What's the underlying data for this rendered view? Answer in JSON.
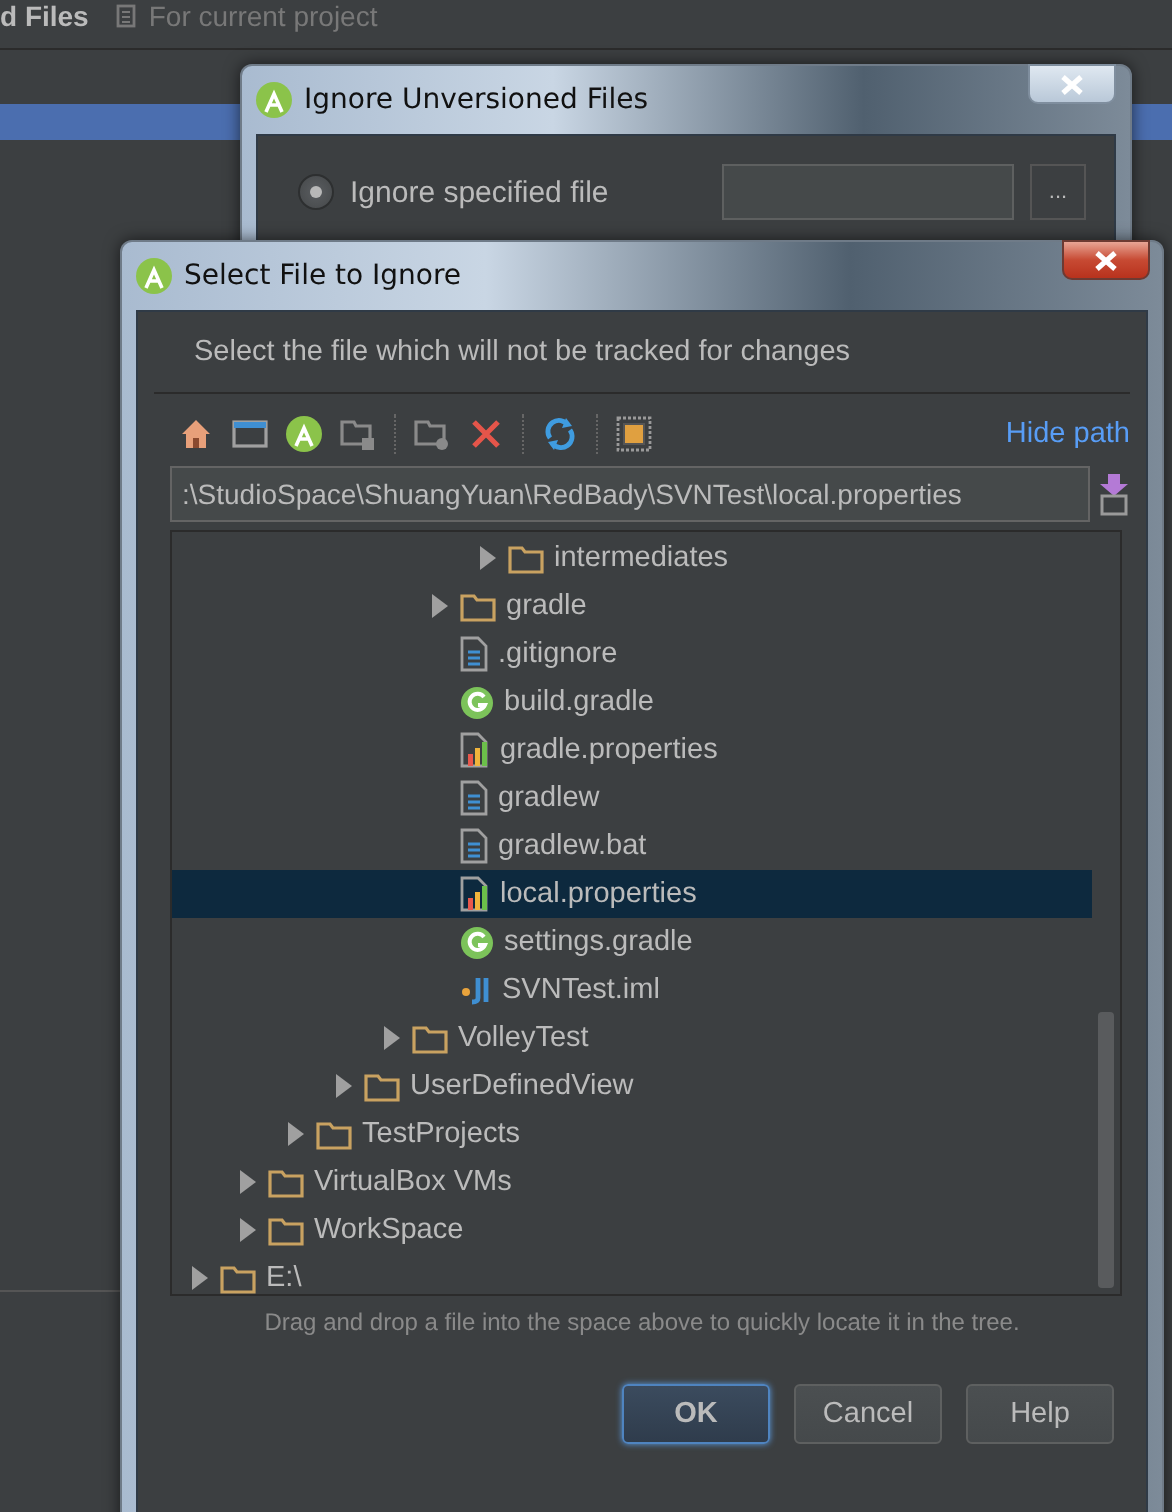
{
  "ide": {
    "title": "d Files",
    "subtitle": "For current project"
  },
  "back_dialog": {
    "title": "Ignore Unversioned Files",
    "option": {
      "label": "Ignore specified file",
      "selected": true
    },
    "browse_button": "..."
  },
  "dialog": {
    "title": "Select File to Ignore",
    "description": "Select the file which will not be tracked for changes",
    "hide_path_link": "Hide path",
    "path": ":\\StudioSpace\\ShuangYuan\\RedBady\\SVNTest\\local.properties",
    "tree": [
      {
        "children": [
          {
            "children": [
              {
                "children": [
                  {
                    "children": [
                      {
                        "children": [
                          {
                            "children": [
                              {
                                "label": "intermediates",
                                "kind": "folder",
                                "expanded": false,
                                "selected": false
                              }
                            ]
                          },
                          {
                            "label": "gradle",
                            "kind": "folder",
                            "expanded": false,
                            "selected": false
                          },
                          {
                            "label": ".gitignore",
                            "kind": "text",
                            "selected": false
                          },
                          {
                            "label": "build.gradle",
                            "kind": "gradle",
                            "selected": false
                          },
                          {
                            "label": "gradle.properties",
                            "kind": "properties",
                            "selected": false
                          },
                          {
                            "label": "gradlew",
                            "kind": "text",
                            "selected": false
                          },
                          {
                            "label": "gradlew.bat",
                            "kind": "text",
                            "selected": false
                          },
                          {
                            "label": "local.properties",
                            "kind": "properties",
                            "selected": true
                          },
                          {
                            "label": "settings.gradle",
                            "kind": "gradle",
                            "selected": false
                          },
                          {
                            "label": "SVNTest.iml",
                            "kind": "module",
                            "selected": false
                          }
                        ]
                      },
                      {
                        "label": "VolleyTest",
                        "kind": "folder",
                        "expanded": false,
                        "selected": false
                      }
                    ]
                  },
                  {
                    "label": "UserDefinedView",
                    "kind": "folder",
                    "expanded": false,
                    "selected": false
                  }
                ]
              },
              {
                "label": "TestProjects",
                "kind": "folder",
                "expanded": false,
                "selected": false
              }
            ]
          },
          {
            "label": "VirtualBox VMs",
            "kind": "folder",
            "expanded": false,
            "selected": false
          },
          {
            "label": "WorkSpace",
            "kind": "folder",
            "expanded": false,
            "selected": false
          }
        ]
      },
      {
        "label": "E:\\",
        "kind": "folder",
        "expanded": false,
        "selected": false
      }
    ],
    "hint": "Drag and drop a file into the space above to quickly locate it in the tree.",
    "buttons": [
      {
        "label": "OK",
        "default": true
      },
      {
        "label": "Cancel",
        "default": false
      },
      {
        "label": "Help",
        "default": false
      }
    ]
  }
}
